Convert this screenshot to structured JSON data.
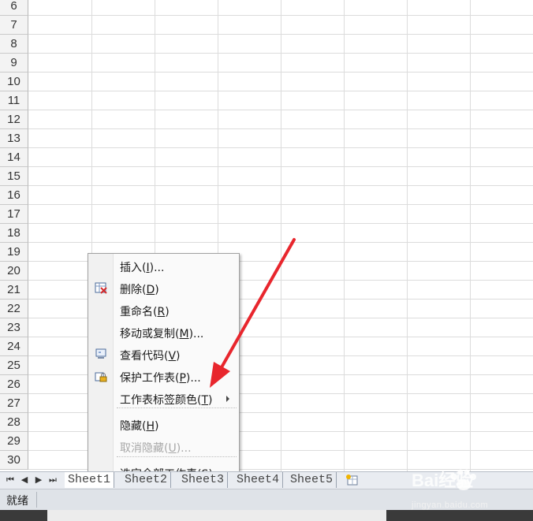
{
  "grid": {
    "rows": [
      "6",
      "7",
      "8",
      "9",
      "10",
      "11",
      "12",
      "13",
      "14",
      "15",
      "16",
      "17",
      "18",
      "19",
      "20",
      "21",
      "22",
      "23",
      "24",
      "25",
      "26",
      "27",
      "28",
      "29",
      "30"
    ]
  },
  "sheet_tabs": {
    "nav": [
      "⏮",
      "◀",
      "▶",
      "⏭"
    ],
    "tabs": [
      "Sheet1",
      "Sheet2",
      "Sheet3",
      "Sheet4",
      "Sheet5"
    ],
    "active": "Sheet1",
    "new_sheet_icon": "insert-sheet-icon"
  },
  "status_bar": {
    "ready": "就绪"
  },
  "context_menu": {
    "items": [
      {
        "text": "插入(",
        "key": "I",
        "suffix": ")...",
        "icon": "",
        "disabled": false
      },
      {
        "text": "删除(",
        "key": "D",
        "suffix": ")",
        "icon": "delete-sheet-icon",
        "disabled": false
      },
      {
        "text": "重命名(",
        "key": "R",
        "suffix": ")",
        "icon": "",
        "disabled": false
      },
      {
        "text": "移动或复制(",
        "key": "M",
        "suffix": ")...",
        "icon": "",
        "disabled": false
      },
      {
        "text": "查看代码(",
        "key": "V",
        "suffix": ")",
        "icon": "view-code-icon",
        "disabled": false
      },
      {
        "text": "保护工作表(",
        "key": "P",
        "suffix": ")...",
        "icon": "protect-sheet-icon",
        "disabled": false
      },
      {
        "text": "工作表标签颜色(",
        "key": "T",
        "suffix": ")",
        "icon": "",
        "disabled": false,
        "submenu": true
      },
      {
        "text": "隐藏(",
        "key": "H",
        "suffix": ")",
        "icon": "",
        "disabled": false
      },
      {
        "text": "取消隐藏(",
        "key": "U",
        "suffix": ")...",
        "icon": "",
        "disabled": true
      },
      {
        "text": "选定全部工作表(",
        "key": "S",
        "suffix": ")",
        "icon": "",
        "disabled": false
      }
    ]
  },
  "watermark": {
    "brand": "Bai经验",
    "url": "jingyan.baidu.com"
  },
  "colors": {
    "arrow": "#e8262d",
    "grid_line": "#dcdcdc",
    "row_header": "#f3f3f3"
  }
}
